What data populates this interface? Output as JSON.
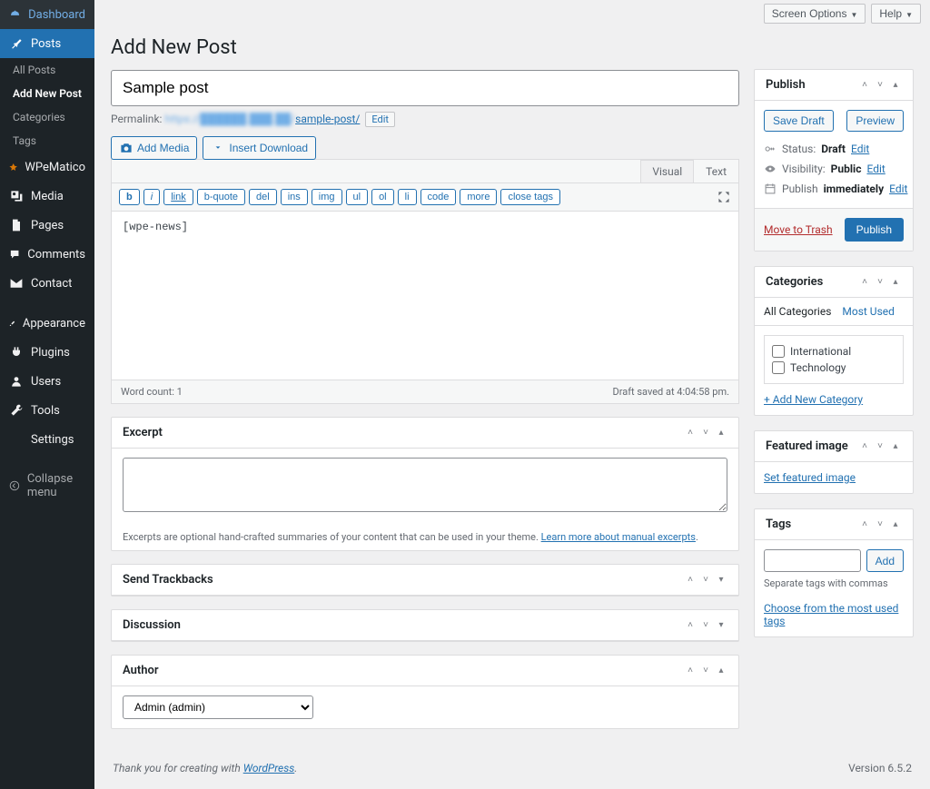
{
  "topbar": {
    "screen_options": "Screen Options",
    "help": "Help"
  },
  "sidebar": {
    "items": [
      {
        "label": "Dashboard"
      },
      {
        "label": "Posts"
      },
      {
        "label": "WPeMatico"
      },
      {
        "label": "Media"
      },
      {
        "label": "Pages"
      },
      {
        "label": "Comments"
      },
      {
        "label": "Contact"
      },
      {
        "label": "Appearance"
      },
      {
        "label": "Plugins"
      },
      {
        "label": "Users"
      },
      {
        "label": "Tools"
      },
      {
        "label": "Settings"
      },
      {
        "label": "Collapse menu"
      }
    ],
    "sub": [
      {
        "label": "All Posts"
      },
      {
        "label": "Add New Post"
      },
      {
        "label": "Categories"
      },
      {
        "label": "Tags"
      }
    ]
  },
  "page": {
    "title": "Add New Post",
    "post_title": "Sample post",
    "permalink_label": "Permalink:",
    "permalink_slug": "sample-post/",
    "edit": "Edit"
  },
  "media": {
    "add": "Add Media",
    "insert": "Insert Download"
  },
  "editor": {
    "tabs": {
      "visual": "Visual",
      "text": "Text"
    },
    "tools": [
      "b",
      "i",
      "link",
      "b-quote",
      "del",
      "ins",
      "img",
      "ul",
      "ol",
      "li",
      "code",
      "more",
      "close tags"
    ],
    "content": "[wpe-news]",
    "wordcount_label": "Word count:",
    "wordcount": "1",
    "saved": "Draft saved at 4:04:58 pm."
  },
  "metaboxes": {
    "excerpt": {
      "title": "Excerpt",
      "note_pre": "Excerpts are optional hand-crafted summaries of your content that can be used in your theme. ",
      "note_link": "Learn more about manual excerpts"
    },
    "trackbacks": {
      "title": "Send Trackbacks"
    },
    "discussion": {
      "title": "Discussion"
    },
    "author": {
      "title": "Author",
      "selected": "Admin (admin)"
    }
  },
  "publish": {
    "title": "Publish",
    "save_draft": "Save Draft",
    "preview": "Preview",
    "status_label": "Status:",
    "status_value": "Draft",
    "visibility_label": "Visibility:",
    "visibility_value": "Public",
    "schedule_label": "Publish",
    "schedule_value": "immediately",
    "edit": "Edit",
    "trash": "Move to Trash",
    "publish_btn": "Publish"
  },
  "categories": {
    "title": "Categories",
    "tab_all": "All Categories",
    "tab_most": "Most Used",
    "items": [
      "International",
      "Technology"
    ],
    "add_new": "+ Add New Category"
  },
  "featured": {
    "title": "Featured image",
    "set": "Set featured image"
  },
  "tags": {
    "title": "Tags",
    "add": "Add",
    "hint": "Separate tags with commas",
    "choose": "Choose from the most used tags"
  },
  "footer": {
    "thank": "Thank you for creating with ",
    "wp": "WordPress",
    "dot": ".",
    "version": "Version 6.5.2"
  }
}
